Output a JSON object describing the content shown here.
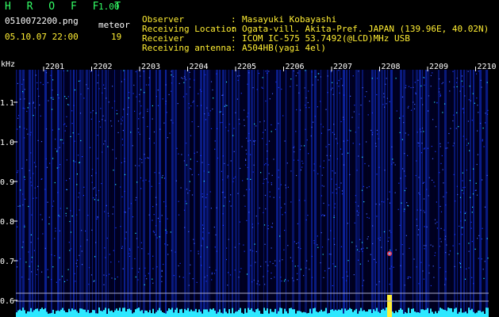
{
  "header": {
    "app_title": "H R O F F T",
    "app_version": "1.00",
    "filename": "0510072200.png",
    "meteor_label": "meteor",
    "datetime": "05.10.07 22:00",
    "meteor_count": "19"
  },
  "info": [
    {
      "key": "Observer",
      "value": "Masayuki Kobayashi"
    },
    {
      "key": "Receiving Location",
      "value": "Ogata-vill. Akita-Pref. JAPAN (139.96E, 40.02N)"
    },
    {
      "key": "Receiver",
      "value": "ICOM IC-575 53.7492(@LCD)MHz USB"
    },
    {
      "key": "Receiving antenna",
      "value": "A504HB(yagi 4el)"
    }
  ],
  "spectrogram": {
    "y_unit": "kHz",
    "y_ticks": [
      "1.1",
      "1.0",
      "0.9",
      "0.8",
      "0.7",
      "0.6"
    ],
    "x_ticks": [
      "2201",
      "2202",
      "2203",
      "2204",
      "2205",
      "2206",
      "2207",
      "2208",
      "2209",
      "2210"
    ],
    "colors": {
      "background": "#000022",
      "signal": "#1a3aff",
      "strong": "#2ee8ff",
      "accent": "#ffee33"
    }
  }
}
